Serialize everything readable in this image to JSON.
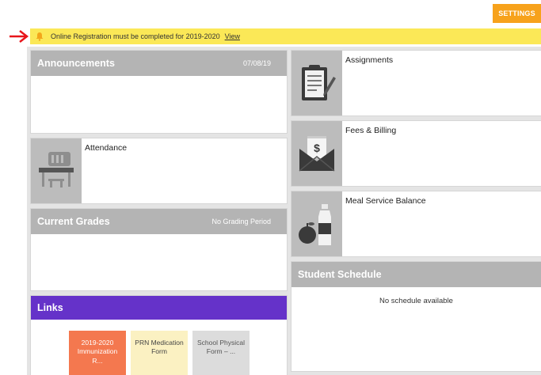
{
  "header": {
    "settings_label": "SETTINGS"
  },
  "notice": {
    "message": "Online Registration must be completed for 2019-2020",
    "link_label": "View"
  },
  "announcements": {
    "title": "Announcements",
    "date": "07/08/19"
  },
  "attendance": {
    "label": "Attendance"
  },
  "grades": {
    "title": "Current Grades",
    "period": "No Grading Period"
  },
  "links": {
    "title": "Links",
    "items": [
      {
        "line1": "2019-2020",
        "line2": "Immunization",
        "line3": "R..."
      },
      {
        "line1": "PRN Medication",
        "line2": "Form",
        "line3": ""
      },
      {
        "line1": "School Physical",
        "line2": "Form – ...",
        "line3": ""
      }
    ]
  },
  "assignments": {
    "label": "Assignments"
  },
  "fees": {
    "label": "Fees & Billing"
  },
  "meal": {
    "label": "Meal Service Balance"
  },
  "schedule": {
    "title": "Student Schedule",
    "empty_text": "No schedule available"
  },
  "colors": {
    "accent_orange": "#f7a21b",
    "notice_yellow": "#fbe857",
    "links_purple": "#6532c9",
    "header_gray": "#b4b4b4",
    "arrow_red": "#e8151b"
  }
}
